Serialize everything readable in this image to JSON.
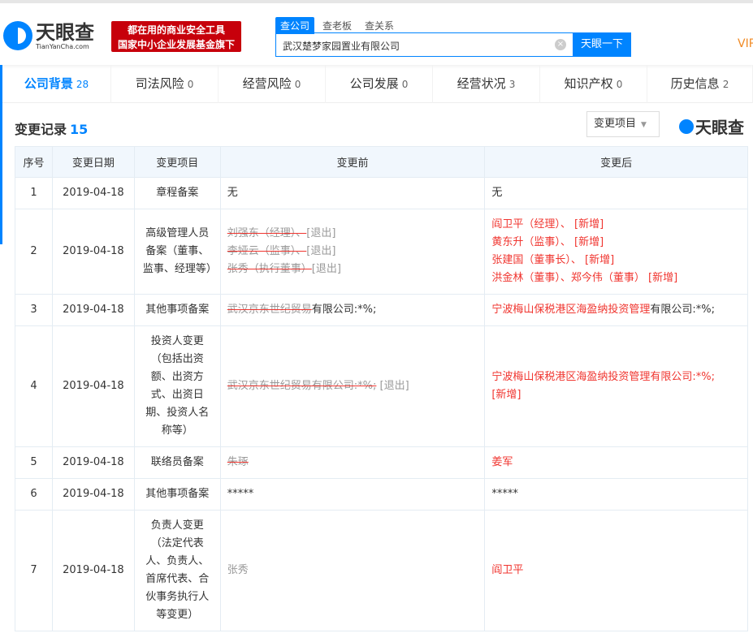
{
  "header": {
    "logo_cn": "天眼查",
    "logo_en": "TianYanCha.com",
    "slogan": [
      "都在用的商业安全工具",
      "国家中小企业发展基金旗下"
    ],
    "search_tabs": [
      "查公司",
      "查老板",
      "查关系"
    ],
    "search_value": "武汉楚梦家园置业有限公司",
    "clear_icon": "×",
    "search_button": "天眼一下",
    "vip": "VIP"
  },
  "nav": [
    {
      "label": "公司背景",
      "count": "28"
    },
    {
      "label": "司法风险",
      "count": "0"
    },
    {
      "label": "经营风险",
      "count": "0"
    },
    {
      "label": "公司发展",
      "count": "0"
    },
    {
      "label": "经营状况",
      "count": "3"
    },
    {
      "label": "知识产权",
      "count": "0"
    },
    {
      "label": "历史信息",
      "count": "2"
    }
  ],
  "section": {
    "title": "变更记录",
    "count": "15",
    "filter": "变更项目",
    "filter_arrow": "▼",
    "watermark": "天眼查"
  },
  "table": {
    "headers": [
      "序号",
      "变更日期",
      "变更项目",
      "变更前",
      "变更后"
    ],
    "rows": [
      {
        "no": "1",
        "date": "2019-04-18",
        "item": "章程备案",
        "before": [
          [
            {
              "t": "无",
              "s": "norm"
            }
          ]
        ],
        "after": [
          [
            {
              "t": "无",
              "s": "norm"
            }
          ]
        ]
      },
      {
        "no": "2",
        "date": "2019-04-18",
        "item": "高级管理人员备案（董事、监事、经理等）",
        "before": [
          [
            {
              "t": "刘强东（经理）、",
              "s": "del"
            },
            {
              "t": "[退出]",
              "s": "dim"
            }
          ],
          [
            {
              "t": "李娅云（监事）、",
              "s": "del"
            },
            {
              "t": "[退出]",
              "s": "dim"
            }
          ],
          [
            {
              "t": "张秀（执行董事）",
              "s": "del"
            },
            {
              "t": "[退出]",
              "s": "dim"
            }
          ]
        ],
        "after": [
          [
            {
              "t": "阎卫平（经理）、 [新增]",
              "s": "new"
            }
          ],
          [
            {
              "t": "黄东升（监事）、 [新增]",
              "s": "new"
            }
          ],
          [
            {
              "t": "张建国（董事长）、 [新增]",
              "s": "new"
            }
          ],
          [
            {
              "t": "洪金林（董事）、郑今伟（董事） [新增]",
              "s": "new"
            }
          ]
        ]
      },
      {
        "no": "3",
        "date": "2019-04-18",
        "item": "其他事项备案",
        "before": [
          [
            {
              "t": "武汉京东世纪贸易",
              "s": "del"
            },
            {
              "t": "有限公司:*%;",
              "s": "norm"
            }
          ]
        ],
        "after": [
          [
            {
              "t": "宁波梅山保税港区海盈纳投资管理",
              "s": "new"
            },
            {
              "t": "有限公司:*%;",
              "s": "norm"
            }
          ]
        ]
      },
      {
        "no": "4",
        "date": "2019-04-18",
        "item": "投资人变更（包括出资额、出资方式、出资日期、投资人名称等）",
        "before": [
          [
            {
              "t": "武汉京东世纪贸易有限公司:*%;",
              "s": "del"
            },
            {
              "t": " [退出]",
              "s": "dim"
            }
          ]
        ],
        "after": [
          [
            {
              "t": "宁波梅山保税港区海盈纳投资管理有限公司:*%;",
              "s": "new"
            }
          ],
          [
            {
              "t": "[新增]",
              "s": "new"
            }
          ]
        ]
      },
      {
        "no": "5",
        "date": "2019-04-18",
        "item": "联络员备案",
        "before": [
          [
            {
              "t": "朱琢",
              "s": "del"
            }
          ]
        ],
        "after": [
          [
            {
              "t": "姜军",
              "s": "new"
            }
          ]
        ]
      },
      {
        "no": "6",
        "date": "2019-04-18",
        "item": "其他事项备案",
        "before": [
          [
            {
              "t": "*****",
              "s": "norm"
            }
          ]
        ],
        "after": [
          [
            {
              "t": "*****",
              "s": "norm"
            }
          ]
        ]
      },
      {
        "no": "7",
        "date": "2019-04-18",
        "item": "负责人变更（法定代表人、负责人、首席代表、合伙事务执行人等变更）",
        "before": [
          [
            {
              "t": "张秀",
              "s": "dim"
            }
          ]
        ],
        "after": [
          [
            {
              "t": "阎卫平",
              "s": "new"
            }
          ]
        ]
      }
    ]
  }
}
